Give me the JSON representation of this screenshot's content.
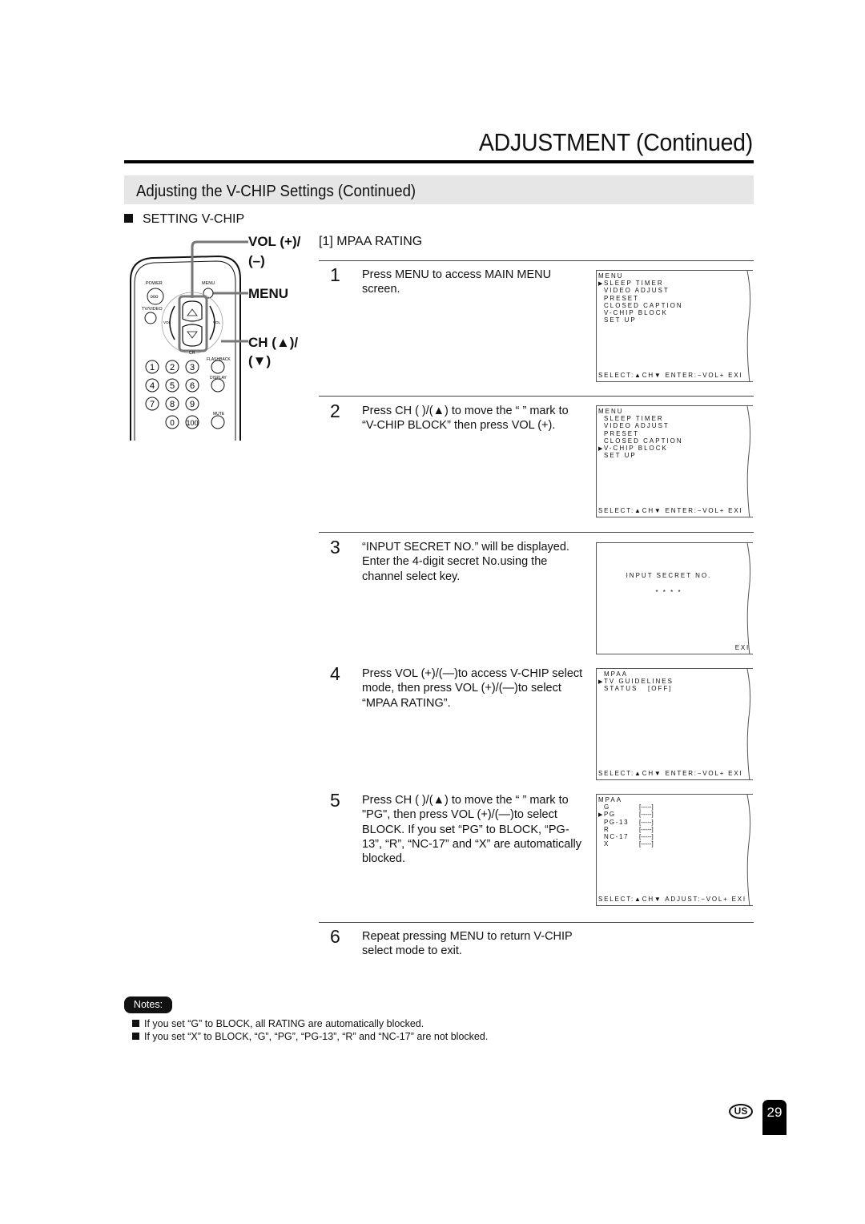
{
  "header": {
    "page_title": "ADJUSTMENT (Continued)",
    "section_title": "Adjusting the V-CHIP Settings (Continued)",
    "subhead": "SETTING V-CHIP"
  },
  "remote": {
    "callouts": {
      "vol_line1": "VOL (+)/",
      "vol_line2": "(–)",
      "menu": "MENU",
      "ch_line1": "CH (▲)/",
      "ch_line2": "(▼)"
    },
    "button_labels": {
      "power": "POWER",
      "menu": "MENU",
      "tv_video": "TV/VIDEO",
      "vol_minus": "VOL –",
      "vol_plus": "VOL +",
      "ch": "CH",
      "flashback": "FLASHBACK",
      "display": "DISPLAY",
      "mute": "MUTE"
    },
    "keys": [
      "1",
      "2",
      "3",
      "4",
      "5",
      "6",
      "7",
      "8",
      "9",
      "0",
      "100"
    ]
  },
  "procedure": {
    "heading": "[1] MPAA RATING",
    "steps": [
      {
        "num": "1",
        "text": "Press MENU to access MAIN MENU screen."
      },
      {
        "num": "2",
        "text": "Press CH (    )/(▲) to move the “    ” mark to “V-CHIP BLOCK” then press VOL (+)."
      },
      {
        "num": "3",
        "text": "“INPUT SECRET NO.” will be displayed. Enter the 4-digit secret No.using the channel select key."
      },
      {
        "num": "4",
        "text": "Press VOL (+)/(—)to access V-CHIP select mode, then press VOL (+)/(—)to select “MPAA RATING”."
      },
      {
        "num": "5",
        "text": "Press CH (    )/(▲) to move the “    ” mark to \"PG\", then press VOL (+)/(—)to select BLOCK. If you set “PG” to BLOCK, “PG-13”, “R”, “NC-17” and “X” are automatically blocked."
      },
      {
        "num": "6",
        "text": "Repeat pressing MENU to return V-CHIP select mode to exit."
      }
    ]
  },
  "screens": {
    "s1": {
      "title": "MENU",
      "items": [
        "SLEEP TIMER",
        "VIDEO ADJUST",
        "PRESET",
        "CLOSED CAPTION",
        "V-CHIP BLOCK",
        "SET UP"
      ],
      "selected_index": 0,
      "footer": "SELECT:▲CH▼ ENTER:−VOL+   EXI"
    },
    "s2": {
      "title": "MENU",
      "items": [
        "SLEEP TIMER",
        "VIDEO ADJUST",
        "PRESET",
        "CLOSED CAPTION",
        "V-CHIP BLOCK",
        "SET UP"
      ],
      "selected_index": 4,
      "footer": "SELECT:▲CH▼ ENTER:−VOL+   EXI"
    },
    "s3": {
      "prompt": "INPUT SECRET NO.",
      "value": "* * * *",
      "footer": "EXI"
    },
    "s4": {
      "items": [
        "MPAA",
        "TV GUIDELINES",
        "STATUS   [OFF]"
      ],
      "selected_index": 1,
      "footer": "SELECT:▲CH▼ ENTER:−VOL+   EXI"
    },
    "s5": {
      "title": "MPAA",
      "ratings": [
        {
          "label": "G",
          "value": "[-----]"
        },
        {
          "label": "PG",
          "value": "[-----]"
        },
        {
          "label": "PG-13",
          "value": "[-----]"
        },
        {
          "label": "R",
          "value": "[-----]"
        },
        {
          "label": "NC-17",
          "value": "[-----]"
        },
        {
          "label": "X",
          "value": "[-----]"
        }
      ],
      "selected_index": 1,
      "footer": "SELECT:▲CH▼ ADJUST:−VOL+ EXI"
    }
  },
  "notes": {
    "badge": "Notes:",
    "items": [
      "If you set “G” to BLOCK, all RATING are automatically blocked.",
      "If you set “X” to BLOCK, “G”, “PG”, “PG-13”, “R” and “NC-17” are not blocked."
    ]
  },
  "footer": {
    "region_badge": "US",
    "page_number": "29"
  }
}
